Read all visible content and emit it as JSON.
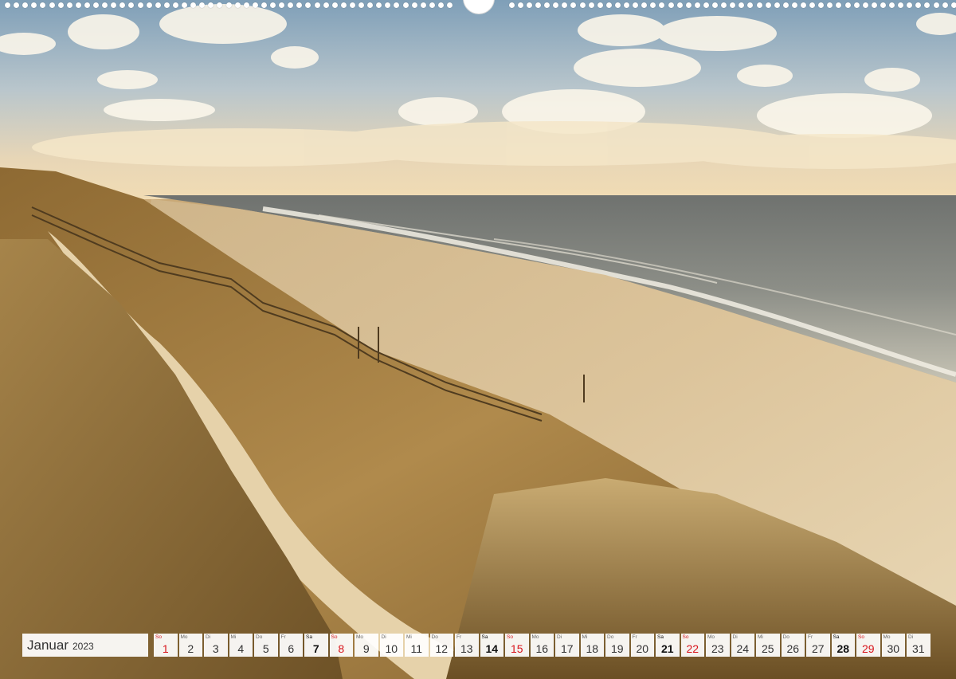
{
  "calendar": {
    "month": "Januar",
    "year": "2023",
    "days": [
      {
        "dow": "So",
        "num": "1",
        "type": "sun"
      },
      {
        "dow": "Mo",
        "num": "2",
        "type": ""
      },
      {
        "dow": "Di",
        "num": "3",
        "type": ""
      },
      {
        "dow": "Mi",
        "num": "4",
        "type": ""
      },
      {
        "dow": "Do",
        "num": "5",
        "type": ""
      },
      {
        "dow": "Fr",
        "num": "6",
        "type": ""
      },
      {
        "dow": "Sa",
        "num": "7",
        "type": "sat"
      },
      {
        "dow": "So",
        "num": "8",
        "type": "sun"
      },
      {
        "dow": "Mo",
        "num": "9",
        "type": ""
      },
      {
        "dow": "Di",
        "num": "10",
        "type": ""
      },
      {
        "dow": "Mi",
        "num": "11",
        "type": ""
      },
      {
        "dow": "Do",
        "num": "12",
        "type": ""
      },
      {
        "dow": "Fr",
        "num": "13",
        "type": ""
      },
      {
        "dow": "Sa",
        "num": "14",
        "type": "sat"
      },
      {
        "dow": "So",
        "num": "15",
        "type": "sun"
      },
      {
        "dow": "Mo",
        "num": "16",
        "type": ""
      },
      {
        "dow": "Di",
        "num": "17",
        "type": ""
      },
      {
        "dow": "Mi",
        "num": "18",
        "type": ""
      },
      {
        "dow": "Do",
        "num": "19",
        "type": ""
      },
      {
        "dow": "Fr",
        "num": "20",
        "type": ""
      },
      {
        "dow": "Sa",
        "num": "21",
        "type": "sat"
      },
      {
        "dow": "So",
        "num": "22",
        "type": "sun"
      },
      {
        "dow": "Mo",
        "num": "23",
        "type": ""
      },
      {
        "dow": "Di",
        "num": "24",
        "type": ""
      },
      {
        "dow": "Mi",
        "num": "25",
        "type": ""
      },
      {
        "dow": "Do",
        "num": "26",
        "type": ""
      },
      {
        "dow": "Fr",
        "num": "27",
        "type": ""
      },
      {
        "dow": "Sa",
        "num": "28",
        "type": "sat"
      },
      {
        "dow": "So",
        "num": "29",
        "type": "sun"
      },
      {
        "dow": "Mo",
        "num": "30",
        "type": ""
      },
      {
        "dow": "Di",
        "num": "31",
        "type": ""
      }
    ]
  },
  "colors": {
    "sunday": "#d8141b",
    "sky_top": "#7f9fb8",
    "sand": "#d9bf93",
    "sea": "#8a8d88",
    "grass": "#a07a3c"
  }
}
